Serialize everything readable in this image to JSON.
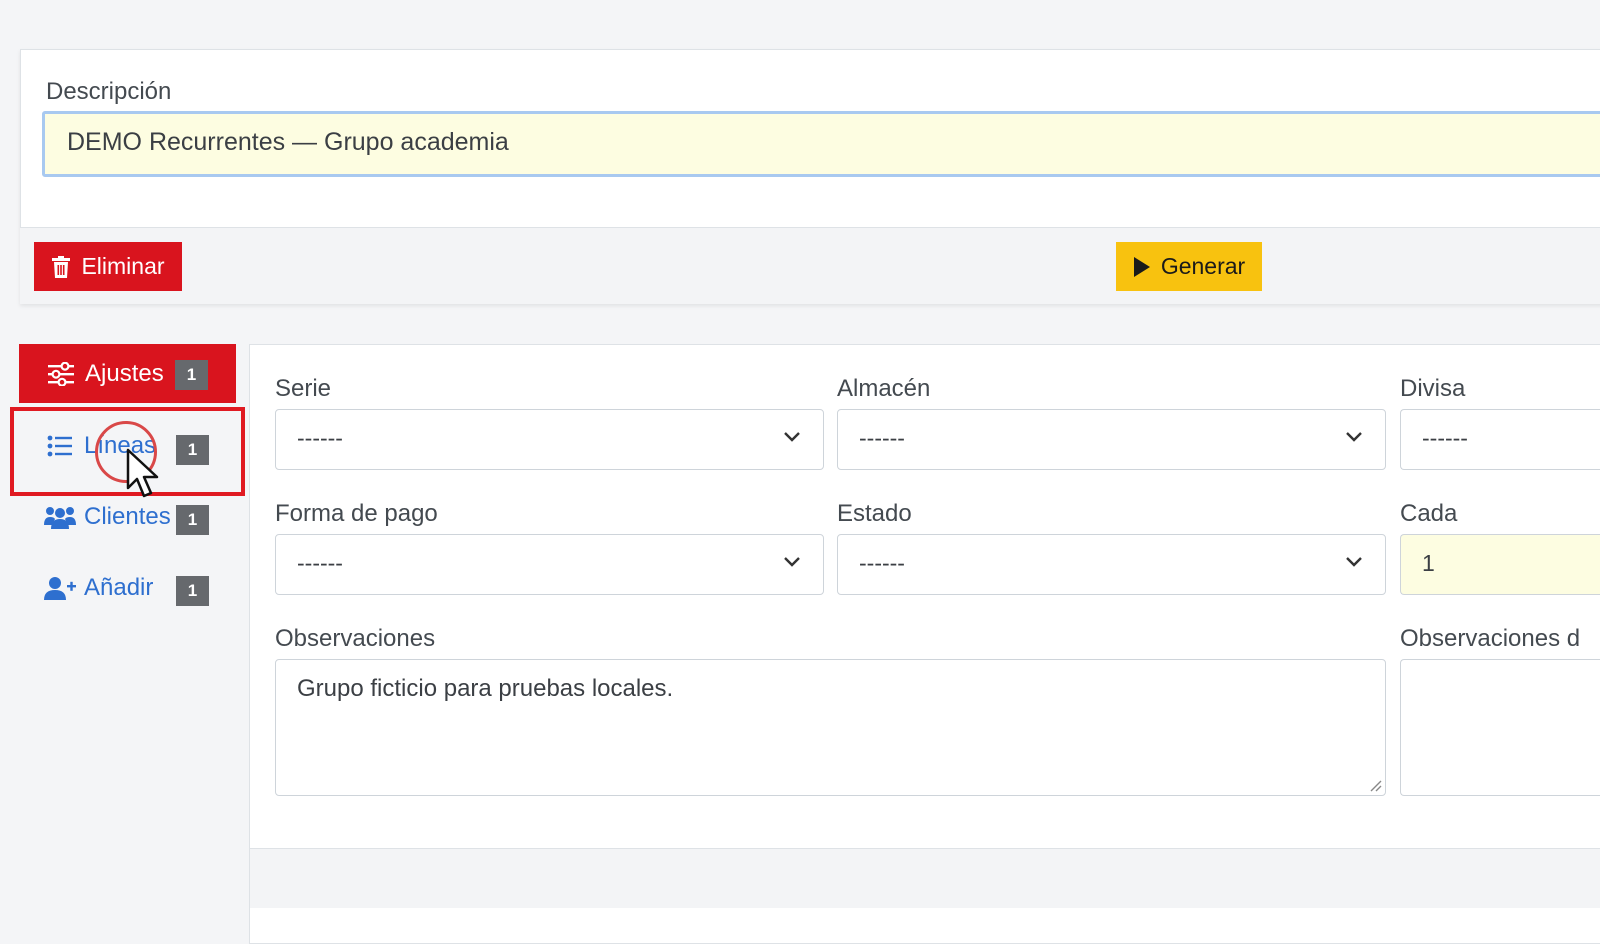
{
  "header": {
    "description_label": "Descripción",
    "description_value": "DEMO Recurrentes — Grupo academia",
    "delete_label": "Eliminar",
    "generate_label": "Generar"
  },
  "sidebar": {
    "items": [
      {
        "label": "Ajustes",
        "badge": "1",
        "icon": "sliders-icon",
        "active": true
      },
      {
        "label": "Líneas",
        "badge": "1",
        "icon": "list-icon",
        "active": false
      },
      {
        "label": "Clientes",
        "badge": "1",
        "icon": "users-icon",
        "active": false
      },
      {
        "label": "Añadir",
        "badge": "1",
        "icon": "user-plus-icon",
        "active": false
      }
    ]
  },
  "form": {
    "serie": {
      "label": "Serie",
      "value": "------"
    },
    "almacen": {
      "label": "Almacén",
      "value": "------"
    },
    "divisa": {
      "label": "Divisa",
      "value": "------"
    },
    "forma_pago": {
      "label": "Forma de pago",
      "value": "------"
    },
    "estado": {
      "label": "Estado",
      "value": "------"
    },
    "cada": {
      "label": "Cada",
      "value": "1"
    },
    "observaciones": {
      "label": "Observaciones",
      "value": "Grupo ficticio para pruebas locales."
    },
    "observaciones_d": {
      "label": "Observaciones d",
      "value": ""
    }
  },
  "colors": {
    "danger": "#d9141e",
    "warning": "#f8c20f",
    "link": "#2e6fcf",
    "badge": "#66696d",
    "input_highlight": "#fdfde1"
  }
}
